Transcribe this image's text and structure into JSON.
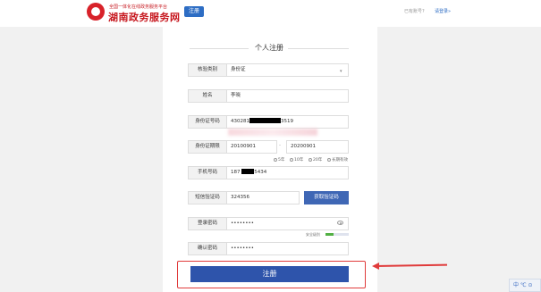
{
  "header": {
    "brand_sub": "全国一体化在线政务服务平台",
    "brand_main": "湖南政务服务网",
    "register_badge": "注册",
    "account_prompt": "已有账号?",
    "login_link": "请登录»"
  },
  "form": {
    "title": "个人注册",
    "verify_type": {
      "label": "核验类别",
      "value": "身份证"
    },
    "name": {
      "label": "姓名",
      "value": "李晓"
    },
    "id_number": {
      "label": "身份证号码",
      "prefix": "430281",
      "suffix": "3519"
    },
    "id_period": {
      "label": "身份证期限",
      "start": "20100901",
      "separator": "-",
      "end": "20200901"
    },
    "period_options": [
      "5年",
      "10年",
      "20年",
      "长期有效"
    ],
    "phone": {
      "label": "手机号码",
      "prefix": "187",
      "suffix": "5434"
    },
    "sms_code": {
      "label": "短信验证码",
      "value": "324356",
      "button": "获取验证码"
    },
    "password": {
      "label": "登录密码",
      "value": "••••••••",
      "strength_label": "安全级别",
      "strength_level": 0.35
    },
    "confirm_password": {
      "label": "确认密码",
      "value": "••••••••"
    },
    "submit": "注册"
  },
  "corner_widget": {
    "text": "中 ℃ ⊙"
  },
  "colors": {
    "accent": "#2e54ab",
    "brand_red": "#c6161d",
    "highlight": "#e03b3b"
  }
}
